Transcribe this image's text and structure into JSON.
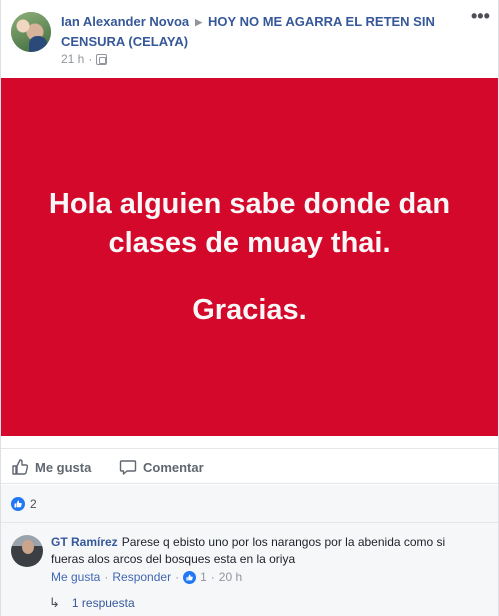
{
  "post": {
    "author": "Ian Alexander Novoa",
    "group": "HOY NO ME AGARRA EL RETEN SIN CENSURA (CELAYA)",
    "time": "21 h",
    "separator": "·",
    "banner_lines": [
      "Hola alguien sabe donde dan",
      "clases de muay thai."
    ],
    "banner_closing": "Gracias."
  },
  "actions": {
    "like_label": "Me gusta",
    "comment_label": "Comentar"
  },
  "reactions": {
    "count": "2"
  },
  "comment": {
    "author": "GT Ramírez",
    "text": "Parese q ebisto uno por los narangos por la abenida como si fueras alos arcos del bosques esta en la oriya",
    "like_link": "Me gusta",
    "reply_link": "Responder",
    "likes": "1",
    "time": "20 h",
    "sep": "·"
  },
  "replies": {
    "label": "1 respuesta"
  },
  "icons": {
    "more": "more-options-icon",
    "privacy": "group-privacy-icon",
    "like": "thumbs-up-icon",
    "comment": "speech-bubble-icon",
    "reply": "reply-arrow-icon"
  },
  "colors": {
    "banner": "#d4082a",
    "link": "#365899",
    "like_blue": "#2078f4"
  }
}
